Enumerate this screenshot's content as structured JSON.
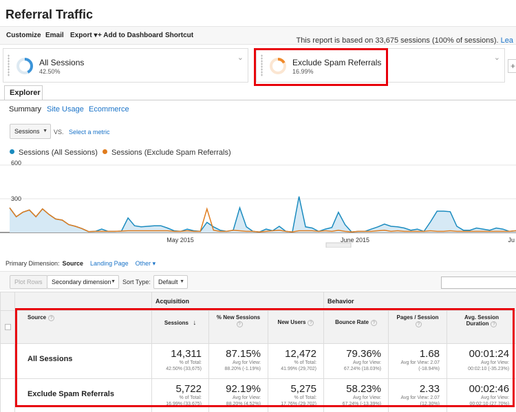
{
  "title": "Referral Traffic",
  "toolbar": {
    "items": [
      "Customize",
      "Email",
      "Export ▾",
      "+ Add to Dashboard",
      "Shortcut"
    ],
    "report_note": "This report is based on 33,675 sessions (100% of sessions).",
    "report_note_link": "Lea"
  },
  "segments": [
    {
      "name": "All Sessions",
      "percent": "42.50%",
      "fraction": 0.425,
      "color": "#3b94d9"
    },
    {
      "name": "Exclude Spam Referrals",
      "percent": "16.99%",
      "fraction": 0.1699,
      "color": "#f08a2b"
    }
  ],
  "add_segment_icon": "plus-icon",
  "tabs": {
    "explorer": "Explorer"
  },
  "subtabs": [
    "Summary",
    "Site Usage",
    "Ecommerce"
  ],
  "metric": {
    "selected": "Sessions",
    "vs": "VS.",
    "select_metric": "Select a metric"
  },
  "legend": [
    {
      "label": "Sessions (All Sessions)",
      "color": "#1a8bbf"
    },
    {
      "label": "Sessions (Exclude Spam Referrals)",
      "color": "#e07c1e"
    }
  ],
  "chart_data": {
    "type": "line",
    "y_ticks": [
      "600",
      "300"
    ],
    "x_ticks": [
      "May 2015",
      "June 2015",
      "Ju"
    ],
    "ylim": [
      0,
      600
    ],
    "series": [
      {
        "name": "Sessions (All Sessions)",
        "color": "#1a8bbf",
        "fill": "#d6e9f5",
        "values": [
          220,
          140,
          180,
          200,
          140,
          210,
          160,
          120,
          110,
          70,
          55,
          35,
          8,
          10,
          30,
          10,
          10,
          12,
          130,
          60,
          50,
          55,
          60,
          60,
          40,
          15,
          10,
          30,
          15,
          10,
          90,
          50,
          20,
          10,
          20,
          220,
          50,
          10,
          5,
          30,
          15,
          55,
          10,
          5,
          320,
          50,
          40,
          10,
          30,
          45,
          180,
          70,
          5,
          10,
          10,
          30,
          50,
          75,
          55,
          50,
          40,
          20,
          30,
          10,
          95,
          190,
          190,
          185,
          55,
          20,
          20,
          40,
          30,
          20,
          40,
          30,
          10,
          15
        ]
      },
      {
        "name": "Sessions (Exclude Spam Referrals)",
        "color": "#e07c1e",
        "values": [
          220,
          140,
          180,
          200,
          140,
          210,
          160,
          120,
          110,
          70,
          55,
          35,
          8,
          10,
          10,
          10,
          10,
          12,
          15,
          15,
          15,
          15,
          15,
          15,
          15,
          10,
          10,
          15,
          10,
          10,
          210,
          20,
          10,
          10,
          20,
          15,
          10,
          10,
          5,
          10,
          15,
          20,
          10,
          5,
          15,
          15,
          15,
          10,
          15,
          10,
          20,
          10,
          5,
          10,
          10,
          10,
          15,
          20,
          10,
          15,
          10,
          10,
          10,
          10,
          15,
          10,
          10,
          15,
          10,
          10,
          10,
          10,
          10,
          10,
          10,
          10,
          10,
          15
        ]
      }
    ]
  },
  "primary_dimension": {
    "label": "Primary Dimension:",
    "value": "Source",
    "options": [
      "Landing Page",
      "Other ▾"
    ]
  },
  "controls": {
    "plot_rows": "Plot Rows",
    "secondary_dimension": "Secondary dimension",
    "sort_type": "Sort Type:",
    "sort_value": "Default"
  },
  "table": {
    "groups": {
      "acquisition": "Acquisition",
      "behavior": "Behavior"
    },
    "source_header": "Source",
    "columns": [
      {
        "label": "Sessions",
        "sub": ""
      },
      {
        "label": "% New Sessions",
        "sub": ""
      },
      {
        "label": "New Users",
        "sub": ""
      },
      {
        "label": "Bounce Rate",
        "sub": ""
      },
      {
        "label": "Pages / Session",
        "sub": ""
      },
      {
        "label": "Avg. Session",
        "sub": "Duration"
      }
    ],
    "rows": [
      {
        "label": "All Sessions",
        "cells": [
          {
            "v": "14,311",
            "s1": "% of Total:",
            "s2": "42.50% (33,675)"
          },
          {
            "v": "87.15%",
            "s1": "Avg for View:",
            "s2": "88.20% (-1.19%)"
          },
          {
            "v": "12,472",
            "s1": "% of Total:",
            "s2": "41.99% (29,702)"
          },
          {
            "v": "79.36%",
            "s1": "Avg for View:",
            "s2": "67.24% (18.03%)"
          },
          {
            "v": "1.68",
            "s1": "Avg for View: 2.07",
            "s2": "(-18.94%)"
          },
          {
            "v": "00:01:24",
            "s1": "Avg for View:",
            "s2": "00:02:10 (-35.23%)"
          }
        ]
      },
      {
        "label": "Exclude Spam Referrals",
        "cells": [
          {
            "v": "5,722",
            "s1": "% of Total:",
            "s2": "16.99% (33,675)"
          },
          {
            "v": "92.19%",
            "s1": "Avg for View:",
            "s2": "88.20% (4.52%)"
          },
          {
            "v": "5,275",
            "s1": "% of Total:",
            "s2": "17.76% (29,702)"
          },
          {
            "v": "58.23%",
            "s1": "Avg for View:",
            "s2": "67.24% (-13.39%)"
          },
          {
            "v": "2.33",
            "s1": "Avg for View: 2.07",
            "s2": "(12.30%)"
          },
          {
            "v": "00:02:46",
            "s1": "Avg for View:",
            "s2": "00:02:10 (27.70%)"
          }
        ]
      }
    ]
  }
}
